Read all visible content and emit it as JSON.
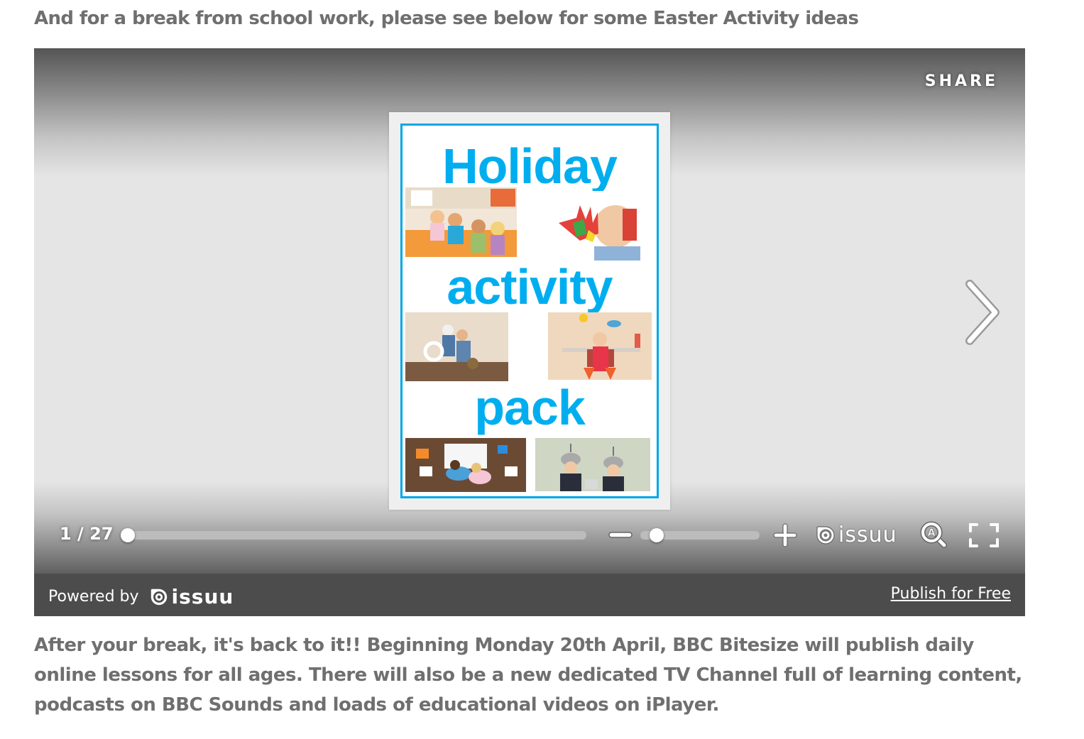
{
  "intro_text": "And for a break from school work, please see below for some Easter Activity ideas",
  "viewer": {
    "share_label": "SHARE",
    "document": {
      "title_lines": [
        "Holiday",
        "activity",
        "pack"
      ],
      "accent_color": "#00aeef",
      "photos": [
        "children-crafting",
        "child-painted-hand",
        "kids-with-telescopes",
        "kid-with-jetpack",
        "kids-drawing-on-floor",
        "kids-with-helmets"
      ]
    },
    "next_icon": "chevron-right-icon",
    "page_indicator": "1 / 27",
    "current_page": 1,
    "total_pages": 27,
    "page_progress": 0.0,
    "zoom_level_fraction": 0.1,
    "icons": {
      "zoom_out": "minus-icon",
      "zoom_in": "plus-icon",
      "brand": "issuu-logo",
      "reader_mode": "magnifier-a-icon",
      "fullscreen": "fullscreen-icon"
    },
    "brand_word": "issuu",
    "footer": {
      "powered_by": "Powered by",
      "brand_word": "issuu",
      "publish_link": "Publish for Free"
    }
  },
  "outro_text": "After your break, it's back to it!! Beginning Monday 20th April, BBC Bitesize will publish daily online lessons for all ages. There will also be a new dedicated TV Channel full of learning content, podcasts on BBC Sounds and loads of educational videos on iPlayer."
}
